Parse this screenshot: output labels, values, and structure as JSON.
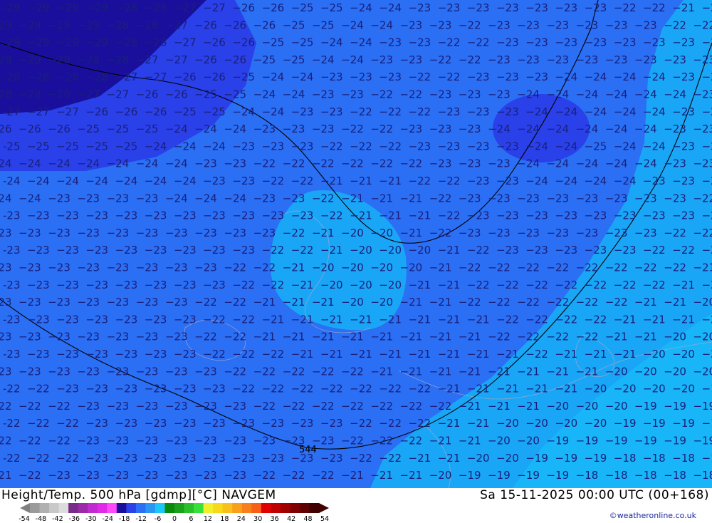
{
  "title": "Height/Temp. 500 hPa [gdmp][°C] NAVGEM",
  "valid_time": "Sa 15-11-2025 00:00 UTC (00+168)",
  "credit": "©weatheronline.co.uk",
  "contour_label": "544",
  "colors": {
    "band_dark": "#1a0f9c",
    "band_mid": "#2a40e8",
    "band_main": "#2a6ff4",
    "band_light": "#1aa6f6",
    "band_cyan": "#18c8f8",
    "label": "#1a1f7a",
    "coast": "#a8a8c8"
  },
  "legend": {
    "ticks": [
      "-54",
      "-48",
      "-42",
      "-36",
      "-30",
      "-24",
      "-18",
      "-12",
      "-6",
      "0",
      "6",
      "12",
      "18",
      "24",
      "30",
      "36",
      "42",
      "48",
      "54"
    ],
    "swatches": [
      "#9a9a9a",
      "#b0b0b0",
      "#c8c8c8",
      "#dcdcdc",
      "#7a2a8a",
      "#9a2aaa",
      "#c02ad0",
      "#e02ae8",
      "#ff4af8",
      "#1a0f9c",
      "#2a40e8",
      "#2a6ff4",
      "#2a96f4",
      "#1ac8f8",
      "#0a8a0a",
      "#1aa01a",
      "#2ac02a",
      "#3ae03a",
      "#f0f02a",
      "#f8d81a",
      "#f8c01a",
      "#f8a01a",
      "#f8801a",
      "#f8601a",
      "#e00000",
      "#c00000",
      "#a00000",
      "#800000",
      "#600000",
      "#400000"
    ]
  },
  "rows": [
    {
      "t": "29  29  29  29  28  28  27  27  26  26  25  25  24  24  23  23  23  23  23  23  23  22  22  21  21  20  20"
    },
    {
      "t": "29  29  29  29  28  28  27  26  26  26  25  25  24  24  23  23  22  23  23  23  23  23  23  22  22  21  20  20"
    },
    {
      "t": "29  29  29  29  28  28  27  26  26  25  25  24  24  23  23  22  22  23  23  23  23  23  23  23  22  22  21  20"
    },
    {
      "t": "29  29  28  28  28  27  27  26  26  25  25  24  24  23  23  22  22  23  23  23  23  23  23  23  23  22  21  20"
    },
    {
      "t": "28  28  28  28  27  27  26  26  25  24  24  23  23  23  22  22  23  23  23  24  24  24  24  23  23  23  22  21"
    },
    {
      "t": "28  28  28  27  27  26  26  25  25  24  24  23  23  22  22  23  23  23  24  24  24  24  24  24  23  23  22  21"
    },
    {
      "t": "27  27  27  26  26  26  25  25  24  24  23  23  22  22  22  23  23  23  24  24  24  24  24  23  23  22  22  22"
    },
    {
      "t": "26  26  26  25  25  25  24  24  24  23  23  23  22  22  23  23  23  24  24  24  24  24  24  23  23  22  22"
    },
    {
      "t": "25  25  25  25  25  24  24  24  23  23  23  22  22  22  23  23  23  23  24  24  25  24  24  23  23  22  21"
    },
    {
      "t": "24  24  24  24  24  24  24  23  23  22  22  22  22  22  22  23  23  23  24  24  24  24  24  23  23  22  21"
    },
    {
      "t": "24  24  24  24  24  24  24  23  23  22  22  21  21  21  22  22  23  23  24  24  24  24  23  23  22  22  21"
    },
    {
      "t": "24  24  23  23  23  23  24  24  24  23  23  22  21  21  21  22  23  23  23  23  23  23  23  23  22  22  21"
    },
    {
      "t": "23  23  23  23  23  23  23  23  23  23  23  22  21  21  21  22  23  23  23  23  23  23  23  23  22  22  21"
    },
    {
      "t": "23  23  23  23  23  23  23  23  23  23  22  21  20  20  21  22  23  23  23  23  23  23  23  22  22  21  21"
    },
    {
      "t": "23  23  23  23  23  23  23  23  23  22  22  21  20  20  20  21  22  23  23  23  23  23  22  22  22  21  21"
    },
    {
      "t": "23  23  23  23  23  23  23  23  22  22  21  20  20  20  20  21  22  22  22  22  22  22  22  22  21  21"
    },
    {
      "t": "23  23  23  23  23  23  23  23  22  22  21  20  20  20  21  21  22  22  22  22  22  22  22  21  21  20"
    },
    {
      "t": "23  23  23  23  23  23  23  22  22  21  21  21  20  20  21  21  22  22  22  22  22  22  21  21  20  20"
    },
    {
      "t": "23  23  23  23  23  23  23  22  22  21  21  21  21  21  21  21  21  22  22  22  22  21  21  21  20  20"
    },
    {
      "t": "23  23  23  23  23  23  23  22  22  21  21  21  21  21  21  21  21  22  22  22  22  21  21  20  20  20"
    },
    {
      "t": "23  23  23  23  23  23  23  22  22  22  21  21  21  21  21  21  21  21  22  21  21  21  20  20  20  19"
    },
    {
      "t": "23  23  23  23  23  23  23  23  22  22  22  22  22  21  21  21  21  21  21  21  21  20  20  20  20  19"
    },
    {
      "t": "22  22  23  23  23  23  23  23  22  22  22  22  22  22  22  21  21  21  21  21  20  20  20  20  19  19"
    },
    {
      "t": "22  22  22  23  23  23  23  23  23  22  22  22  22  22  22  22  21  21  21  20  20  20  19  19  19  19"
    },
    {
      "t": "22  22  22  23  23  23  23  23  23  23  23  23  22  22  22  21  21  20  20  20  20  19  19  19  19  19"
    },
    {
      "t": "22  22  22  23  23  23  23  23  23  23  23  23  22  22  22  21  21  20  20  19  19  19  19  19  19"
    },
    {
      "t": "22  22  22  23  23  23  23  23  23  23  23  23  22  22  21  21  20  20  19  19  19  18  18  18  19"
    },
    {
      "t": "21  22  23  23  23  23  23  23  23  22  22  22  21  21  21  20  19  19  19  19  18  18  18  18  18"
    }
  ]
}
